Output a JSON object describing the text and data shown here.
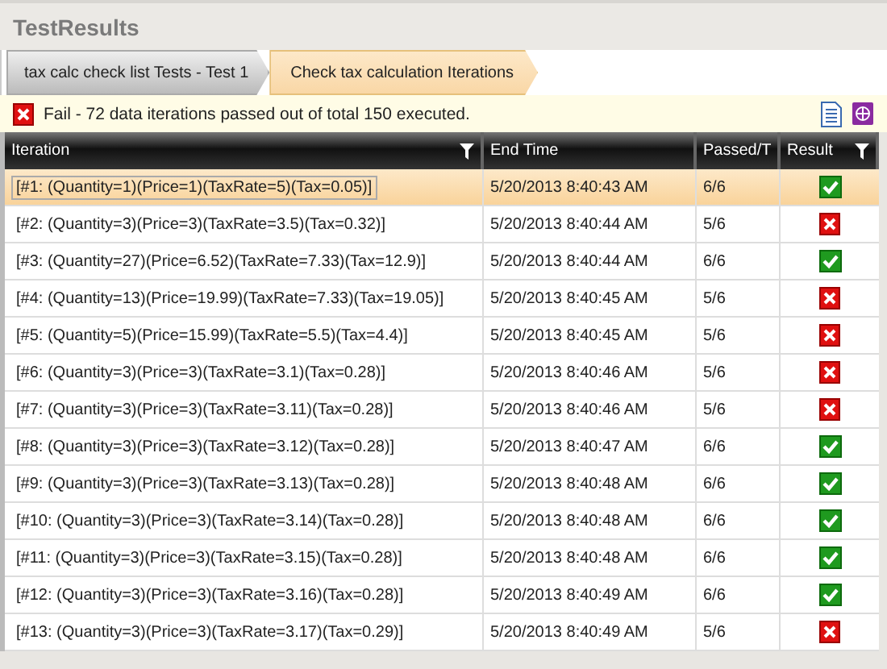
{
  "window": {
    "title": "TestResults"
  },
  "breadcrumb": [
    {
      "label": "tax calc check list Tests - Test 1",
      "selected": false
    },
    {
      "label": "Check tax calculation Iterations",
      "selected": true
    }
  ],
  "summary": {
    "passed": false,
    "text": "Fail - 72 data iterations passed out of total 150 executed."
  },
  "table": {
    "columns": [
      {
        "label": "Iteration",
        "filter": true
      },
      {
        "label": "End Time",
        "filter": false
      },
      {
        "label": "Passed/T",
        "filter": false
      },
      {
        "label": "Result",
        "filter": true
      }
    ],
    "rows": [
      {
        "iteration": "[#1: (Quantity=1)(Price=1)(TaxRate=5)(Tax=0.05)]",
        "end_time": "5/20/2013 8:40:43 AM",
        "passed": "6/6",
        "passed_result": true,
        "selected": true
      },
      {
        "iteration": "[#2: (Quantity=3)(Price=3)(TaxRate=3.5)(Tax=0.32)]",
        "end_time": "5/20/2013 8:40:44 AM",
        "passed": "5/6",
        "passed_result": false,
        "selected": false
      },
      {
        "iteration": "[#3: (Quantity=27)(Price=6.52)(TaxRate=7.33)(Tax=12.9)]",
        "end_time": "5/20/2013 8:40:44 AM",
        "passed": "6/6",
        "passed_result": true,
        "selected": false
      },
      {
        "iteration": "[#4: (Quantity=13)(Price=19.99)(TaxRate=7.33)(Tax=19.05)]",
        "end_time": "5/20/2013 8:40:45 AM",
        "passed": "5/6",
        "passed_result": false,
        "selected": false
      },
      {
        "iteration": "[#5: (Quantity=5)(Price=15.99)(TaxRate=5.5)(Tax=4.4)]",
        "end_time": "5/20/2013 8:40:45 AM",
        "passed": "5/6",
        "passed_result": false,
        "selected": false
      },
      {
        "iteration": "[#6: (Quantity=3)(Price=3)(TaxRate=3.1)(Tax=0.28)]",
        "end_time": "5/20/2013 8:40:46 AM",
        "passed": "5/6",
        "passed_result": false,
        "selected": false
      },
      {
        "iteration": "[#7: (Quantity=3)(Price=3)(TaxRate=3.11)(Tax=0.28)]",
        "end_time": "5/20/2013 8:40:46 AM",
        "passed": "5/6",
        "passed_result": false,
        "selected": false
      },
      {
        "iteration": "[#8: (Quantity=3)(Price=3)(TaxRate=3.12)(Tax=0.28)]",
        "end_time": "5/20/2013 8:40:47 AM",
        "passed": "6/6",
        "passed_result": true,
        "selected": false
      },
      {
        "iteration": "[#9: (Quantity=3)(Price=3)(TaxRate=3.13)(Tax=0.28)]",
        "end_time": "5/20/2013 8:40:48 AM",
        "passed": "6/6",
        "passed_result": true,
        "selected": false
      },
      {
        "iteration": "[#10: (Quantity=3)(Price=3)(TaxRate=3.14)(Tax=0.28)]",
        "end_time": "5/20/2013 8:40:48 AM",
        "passed": "6/6",
        "passed_result": true,
        "selected": false
      },
      {
        "iteration": "[#11: (Quantity=3)(Price=3)(TaxRate=3.15)(Tax=0.28)]",
        "end_time": "5/20/2013 8:40:48 AM",
        "passed": "6/6",
        "passed_result": true,
        "selected": false
      },
      {
        "iteration": "[#12: (Quantity=3)(Price=3)(TaxRate=3.16)(Tax=0.28)]",
        "end_time": "5/20/2013 8:40:49 AM",
        "passed": "6/6",
        "passed_result": true,
        "selected": false
      },
      {
        "iteration": "[#13: (Quantity=3)(Price=3)(TaxRate=3.17)(Tax=0.29)]",
        "end_time": "5/20/2013 8:40:49 AM",
        "passed": "5/6",
        "passed_result": false,
        "selected": false
      }
    ]
  }
}
